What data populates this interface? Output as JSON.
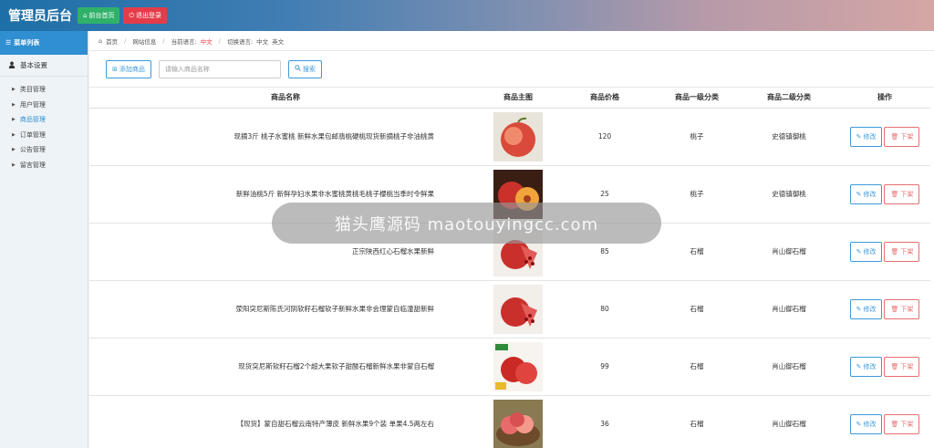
{
  "header": {
    "title": "管理员后台",
    "home_button": "前台首页",
    "logout_button": "退出登录"
  },
  "sidebar": {
    "menu_title": "菜单列表",
    "group_label": "基本设置",
    "items": [
      {
        "label": "类目管理",
        "active": false
      },
      {
        "label": "用户管理",
        "active": false
      },
      {
        "label": "商品管理",
        "active": true
      },
      {
        "label": "订单管理",
        "active": false
      },
      {
        "label": "公告管理",
        "active": false
      },
      {
        "label": "留言管理",
        "active": false
      }
    ]
  },
  "breadcrumb": {
    "home": "首页",
    "site": "网站信息",
    "current_lang_label": "当前语言:",
    "current_lang": "中文",
    "switch_lang_label": "切换语言:",
    "lang_zh": "中文",
    "lang_en": "英文"
  },
  "toolbar": {
    "add_button": "添加商品",
    "search_placeholder": "请输入商品名称",
    "search_button": "搜索"
  },
  "table": {
    "headers": [
      "商品名称",
      "商品主图",
      "商品价格",
      "商品一级分类",
      "商品二级分类",
      "操作"
    ],
    "edit_label": "修改",
    "down_label": "下架",
    "rows": [
      {
        "name": "现摘3斤 桃子水蜜桃 新鲜水果包邮翡桃硬桃现货新摘桃子非油桃黄",
        "price": "120",
        "cat1": "桃子",
        "cat2": "史德镇御桃",
        "img": "peach-photo"
      },
      {
        "name": "新鲜油桃5斤 新鲜孕妇水果非水蜜桃黄桃毛桃子櫻桃当季时令鲜果",
        "price": "25",
        "cat1": "桃子",
        "cat2": "史德镇御桃",
        "img": "nectarine-photo"
      },
      {
        "name": "正宗陕西红心石榴水果新鲜",
        "price": "85",
        "cat1": "石榴",
        "cat2": "肖山御石榴",
        "img": "pomegranate-photo"
      },
      {
        "name": "荥阳突尼斯陈氏河阴软籽石榴软子新鲜水果非会理蒙自临潼甜新鲜",
        "price": "80",
        "cat1": "石榴",
        "cat2": "肖山御石榴",
        "img": "pomegranate-photo"
      },
      {
        "name": "现货突尼斯软籽石榴2个超大果软子甜酸石榴新鲜水果非蒙自石榴",
        "price": "99",
        "cat1": "石榴",
        "cat2": "肖山御石榴",
        "img": "pomegranate-box-photo"
      },
      {
        "name": "【现货】蒙自甜石榴云南特产薄皮 新鲜水果9个装 单果4.5两左右",
        "price": "36",
        "cat1": "石榴",
        "cat2": "肖山御石榴",
        "img": "pomegranate-basket-photo"
      }
    ]
  },
  "watermark": "猫头鹰源码 maotouyingcc.com"
}
